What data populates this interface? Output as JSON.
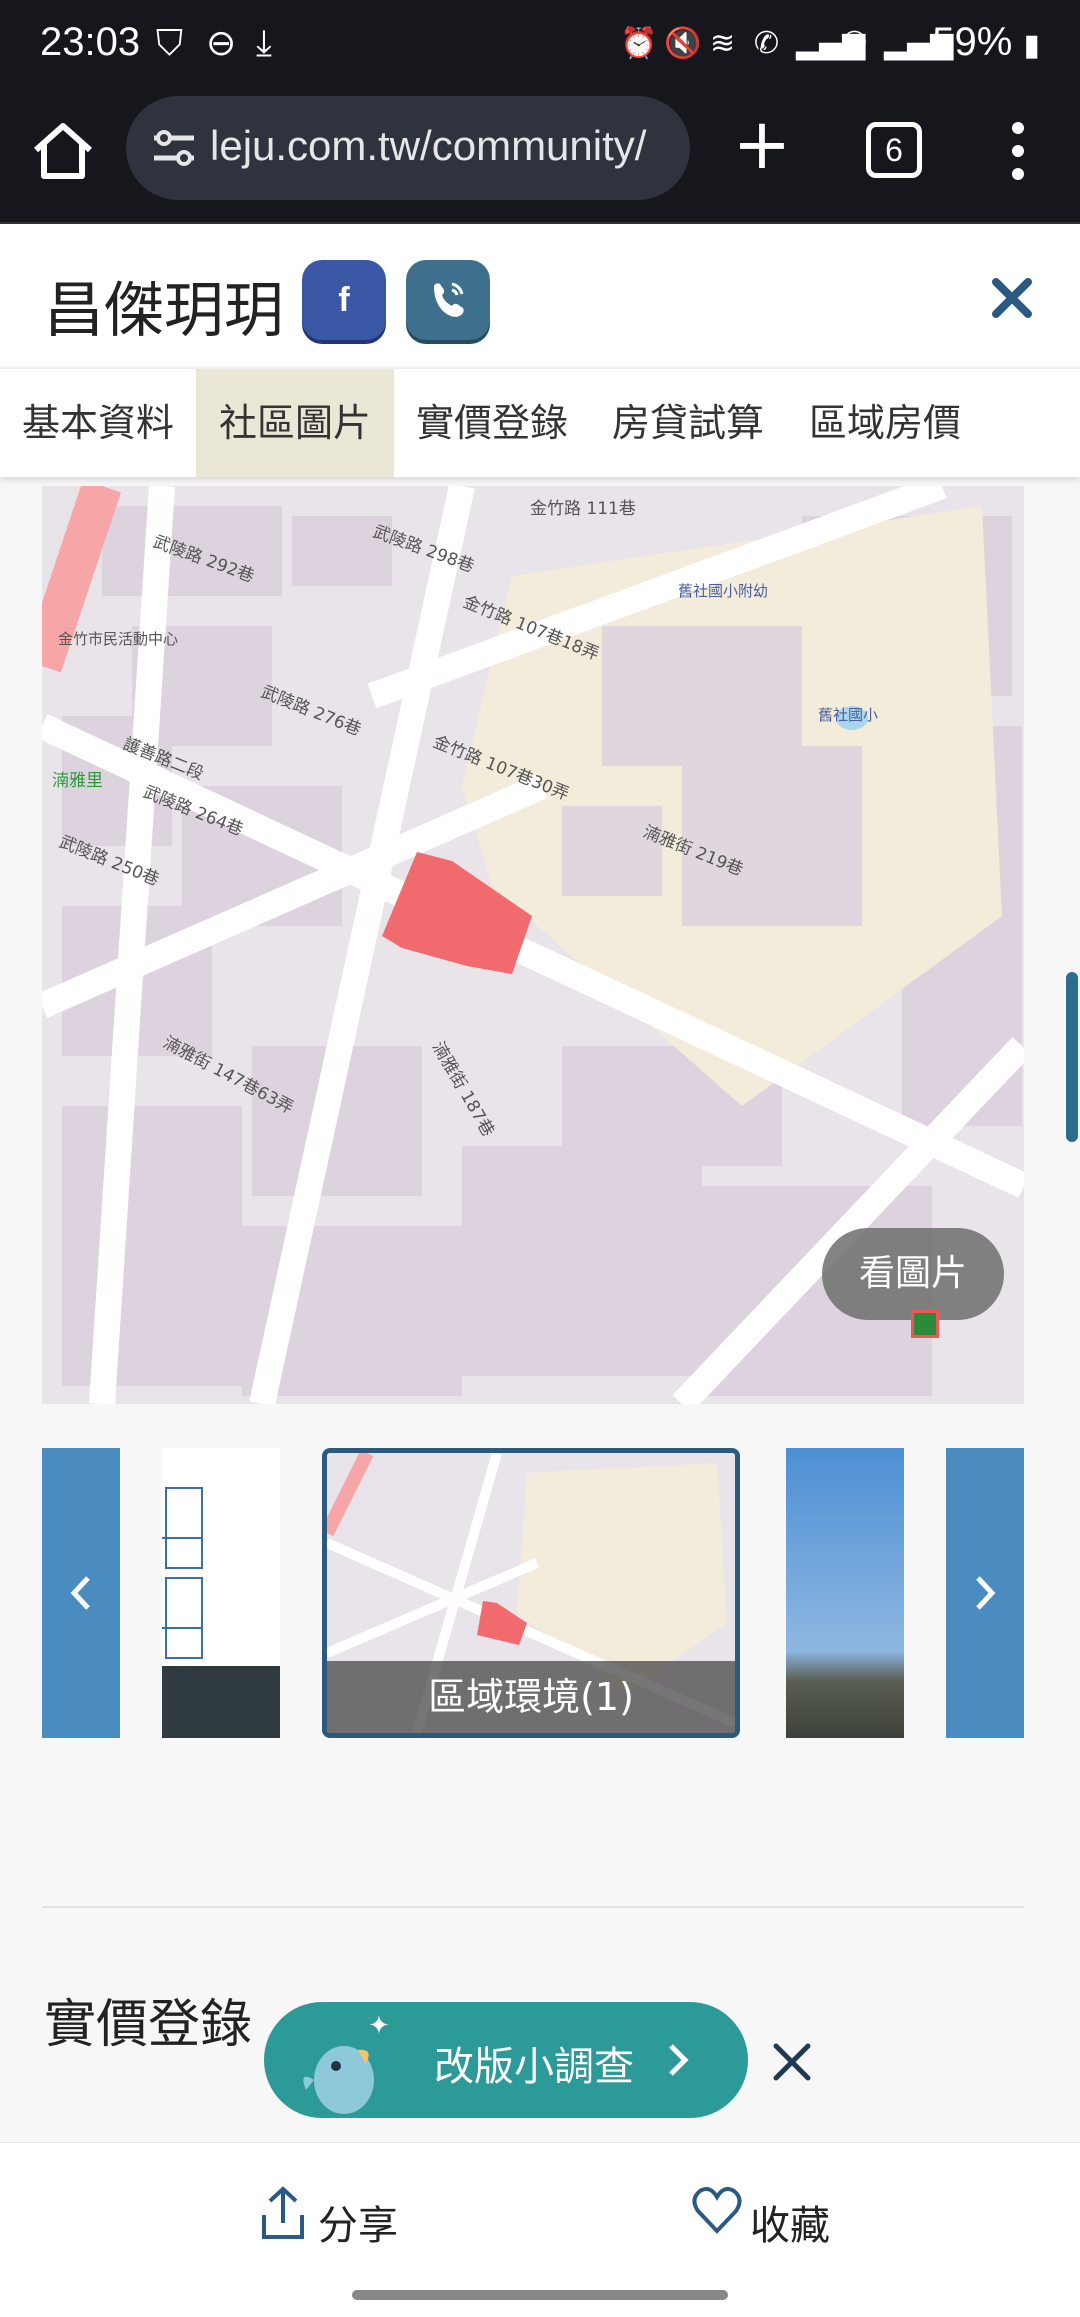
{
  "status_bar": {
    "time": "23:03",
    "battery": "59%",
    "icons": [
      "shield-icon",
      "dnd-icon",
      "download-icon",
      "alarm-icon",
      "mute-icon",
      "wifi-icon",
      "wifi-calling-icon",
      "signal-icon",
      "wifi-calling-2-icon",
      "signal-2-icon",
      "battery-icon"
    ]
  },
  "browser": {
    "url": "leju.com.tw/community/",
    "tab_count": "6"
  },
  "header": {
    "title": "昌傑玥玥",
    "facebook_label": "f"
  },
  "tabs": [
    {
      "label": "基本資料",
      "active": false
    },
    {
      "label": "社區圖片",
      "active": true
    },
    {
      "label": "實價登錄",
      "active": false
    },
    {
      "label": "房貸試算",
      "active": false
    },
    {
      "label": "區域房價",
      "active": false
    }
  ],
  "map": {
    "labels": {
      "street1": "金竹路 111巷",
      "street2": "武陵路 292巷",
      "street3": "武陵路 298巷",
      "street4": "金竹路 107巷18弄",
      "center": "金竹市民活動中心",
      "street5": "武陵路 276巷",
      "street6": "金竹路 107巷30弄",
      "street7": "護善路二段",
      "district": "湳雅里",
      "street8": "武陵路 264巷",
      "street9": "武陵路 250巷",
      "street10": "湳雅街 219巷",
      "school1": "舊社國小附幼",
      "school2": "舊社國小",
      "street11": "湳雅街 147巷63弄",
      "street12": "湳雅街 187巷"
    },
    "view_button": "看圖片"
  },
  "thumbnails": {
    "caption": "區域環境(1)"
  },
  "section": {
    "title": "實價登錄"
  },
  "survey": {
    "label": "改版小調查"
  },
  "bottom": {
    "share": "分享",
    "favorite": "收藏"
  },
  "colors": {
    "accent": "#2c9a98",
    "nav_active": "#ebe7d6",
    "thumb_nav": "#4a8cc0",
    "parcel": "#f06a6e"
  }
}
